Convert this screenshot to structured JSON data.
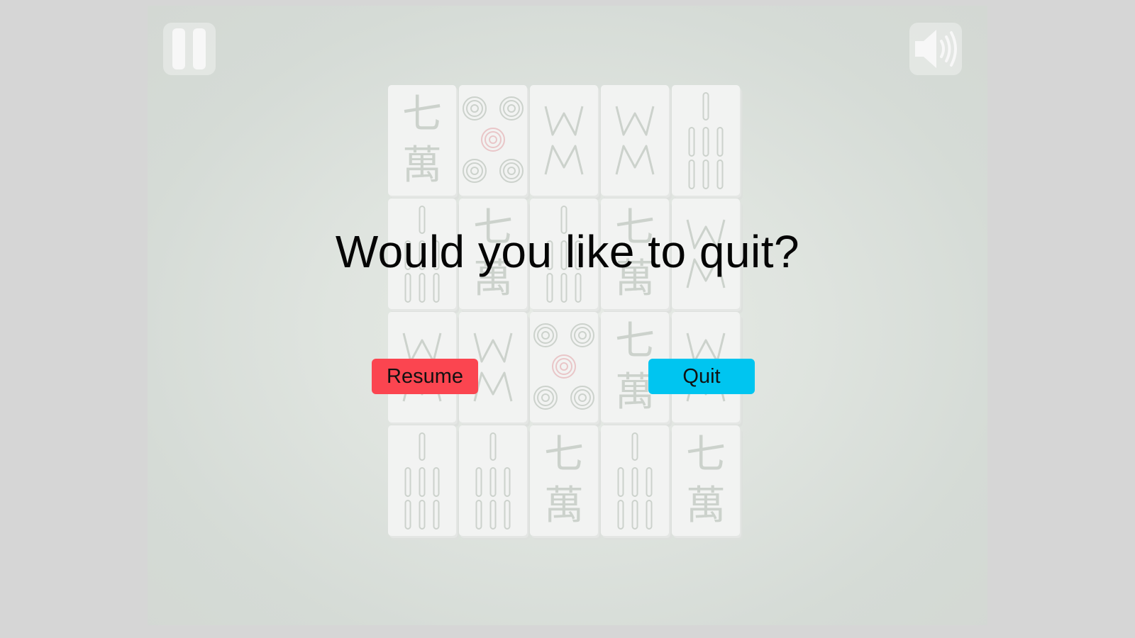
{
  "dialog": {
    "title": "Would you like to quit?",
    "resume_label": "Resume",
    "quit_label": "Quit"
  },
  "colors": {
    "resume": "#fb4550",
    "quit": "#00c5f0",
    "tile_face": "#f2f3f2",
    "tile_glyph": "#ccd2cc"
  },
  "toolbar": {
    "pause_icon": "pause-icon",
    "sound_icon": "speaker-icon"
  },
  "board": {
    "tiles": [
      [
        "character-seven",
        "circle-five",
        "bamboo-w",
        "bamboo-w",
        "bamboo-seven"
      ],
      [
        "bamboo-seven",
        "character-seven",
        "bamboo-seven",
        "character-seven",
        "bamboo-w"
      ],
      [
        "bamboo-w",
        "bamboo-w",
        "circle-five",
        "character-seven",
        "bamboo-w"
      ],
      [
        "bamboo-seven",
        "bamboo-seven",
        "character-seven",
        "bamboo-seven",
        "character-seven"
      ]
    ],
    "glyphs": {
      "seven": "七",
      "wan": "萬"
    }
  }
}
